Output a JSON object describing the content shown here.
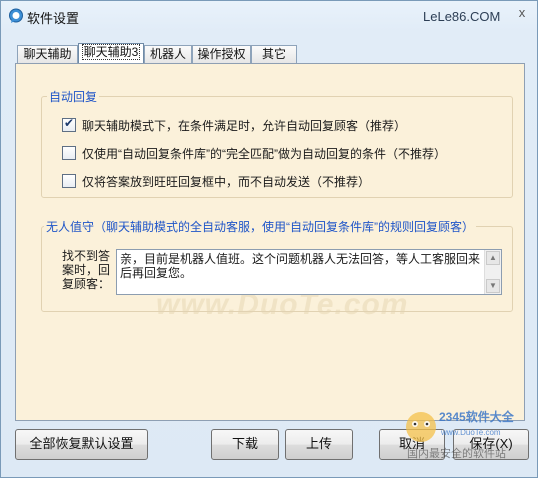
{
  "window": {
    "title": "软件设置",
    "site": "LeLe86.COM",
    "close": "x"
  },
  "tabs": [
    {
      "label": "聊天辅助",
      "active": false
    },
    {
      "label": "聊天辅助3",
      "active": true
    },
    {
      "label": "机器人",
      "active": false
    },
    {
      "label": "操作授权",
      "active": false
    },
    {
      "label": "其它",
      "active": false
    }
  ],
  "auto_reply": {
    "title": "自动回复",
    "options": [
      {
        "label": "聊天辅助模式下，在条件满足时，允许自动回复顾客（推荐）",
        "checked": true
      },
      {
        "label": "仅使用“自动回复条件库”的“完全匹配”做为自动回复的条件（不推荐）",
        "checked": false
      },
      {
        "label": "仅将答案放到旺旺回复框中，而不自动发送（不推荐）",
        "checked": false
      }
    ]
  },
  "unattended": {
    "title": "无人值守（聊天辅助模式的全自动客服，使用“自动回复条件库”的规则回复顾客）",
    "field_label": "找不到答案时，回复顾客：",
    "reply_text": "亲，目前是机器人值班。这个问题机器人无法回答，等人工客服回来后再回复您。"
  },
  "buttons": {
    "restore_defaults": "全部恢复默认设置",
    "download": "下载",
    "upload": "上传",
    "cancel": "取消",
    "save": "保存(X)"
  },
  "watermark": {
    "center": "www.DuoTe.com",
    "logo_text": "2345软件大全",
    "logo_url": "www.DuoTe.com",
    "logo_caption": "国内最安全的软件站"
  },
  "colors": {
    "panel_bg": "#fbf1da",
    "group_title": "#1f55c8",
    "window_bg": "#e1ecf7"
  }
}
